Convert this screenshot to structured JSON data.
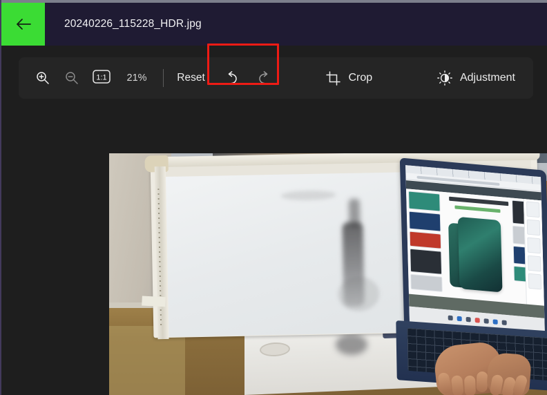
{
  "window": {
    "title": "20240226_115228_HDR.jpg",
    "back_icon": "arrow-left-icon",
    "back_button_color": "#3bdc34",
    "titlebar_color": "#1f1b33"
  },
  "toolbar": {
    "zoom_in_icon": "zoom-in-icon",
    "zoom_out_icon": "zoom-out-icon",
    "actual_size_label": "1:1",
    "zoom_level": "21%",
    "reset_label": "Reset",
    "undo_icon": "undo-icon",
    "redo_icon": "redo-icon",
    "crop_icon": "crop-icon",
    "crop_label": "Crop",
    "adjustment_icon": "brightness-icon",
    "adjustment_label": "Adjustment"
  },
  "annotation": {
    "color": "#ee1b15",
    "target": "undo-redo-group"
  },
  "photo": {
    "description": "Photo of a white-framed whiteboard in a room with an orange wall panel, a desk, a printer and a laptop with hands typing on the keyboard",
    "alt": "20240226_115228_HDR.jpg"
  }
}
